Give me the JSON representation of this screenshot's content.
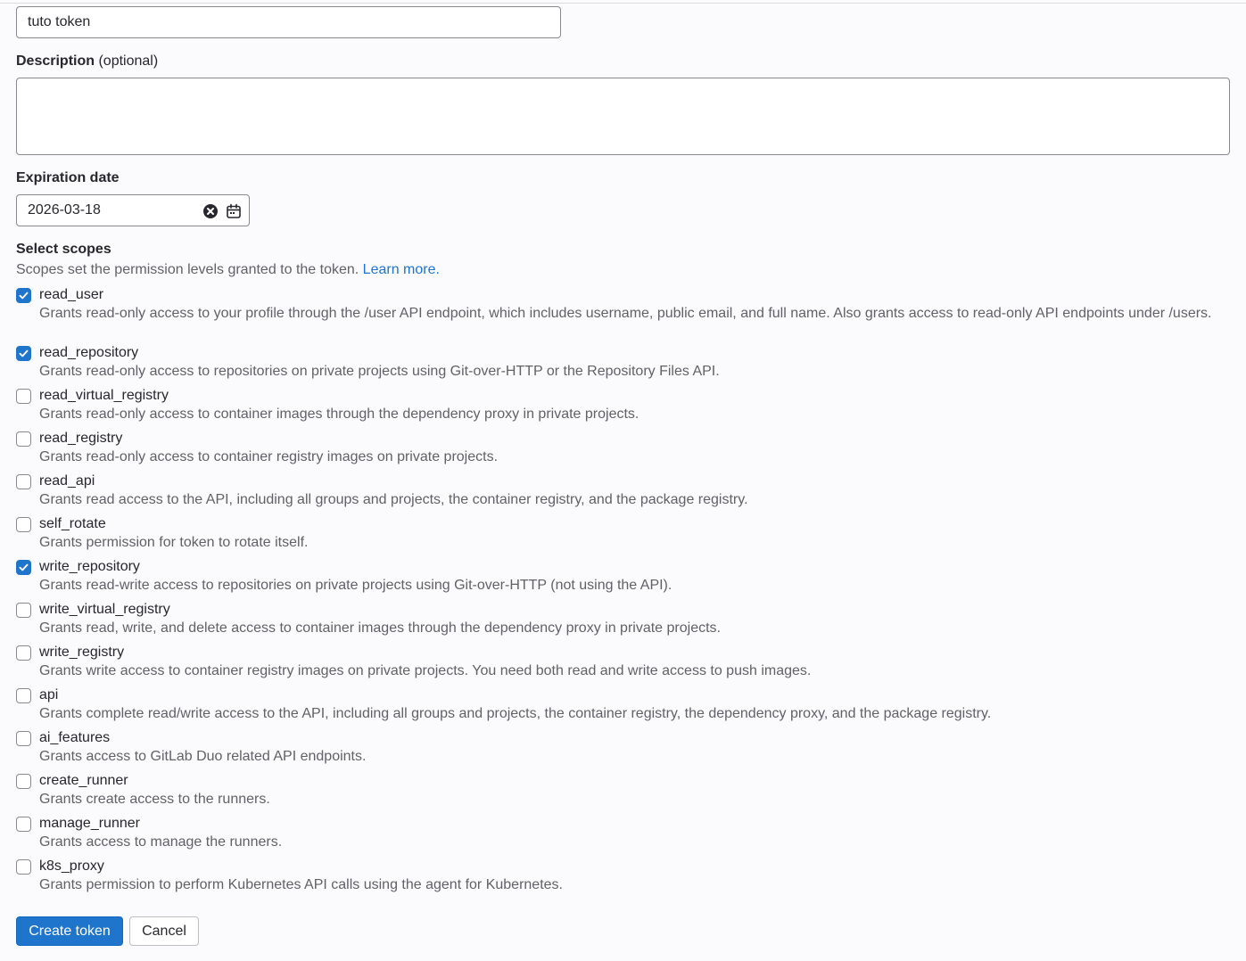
{
  "form": {
    "token_name_value": "tuto token",
    "description_label": "Description",
    "description_optional": "(optional)",
    "description_value": "",
    "expiration_label": "Expiration date",
    "expiration_value": "2026-03-18",
    "scopes_label": "Select scopes",
    "scopes_help": "Scopes set the permission levels granted to the token.",
    "scopes_help_link": "Learn more."
  },
  "scopes": [
    {
      "name": "read_user",
      "checked": true,
      "description": "Grants read-only access to your profile through the /user API endpoint, which includes username, public email, and full name. Also grants access to read-only API endpoints under /users."
    },
    {
      "name": "read_repository",
      "checked": true,
      "description": "Grants read-only access to repositories on private projects using Git-over-HTTP or the Repository Files API."
    },
    {
      "name": "read_virtual_registry",
      "checked": false,
      "description": "Grants read-only access to container images through the dependency proxy in private projects."
    },
    {
      "name": "read_registry",
      "checked": false,
      "description": "Grants read-only access to container registry images on private projects."
    },
    {
      "name": "read_api",
      "checked": false,
      "description": "Grants read access to the API, including all groups and projects, the container registry, and the package registry."
    },
    {
      "name": "self_rotate",
      "checked": false,
      "description": "Grants permission for token to rotate itself."
    },
    {
      "name": "write_repository",
      "checked": true,
      "description": "Grants read-write access to repositories on private projects using Git-over-HTTP (not using the API)."
    },
    {
      "name": "write_virtual_registry",
      "checked": false,
      "description": "Grants read, write, and delete access to container images through the dependency proxy in private projects."
    },
    {
      "name": "write_registry",
      "checked": false,
      "description": "Grants write access to container registry images on private projects. You need both read and write access to push images."
    },
    {
      "name": "api",
      "checked": false,
      "description": "Grants complete read/write access to the API, including all groups and projects, the container registry, the dependency proxy, and the package registry."
    },
    {
      "name": "ai_features",
      "checked": false,
      "description": "Grants access to GitLab Duo related API endpoints."
    },
    {
      "name": "create_runner",
      "checked": false,
      "description": "Grants create access to the runners."
    },
    {
      "name": "manage_runner",
      "checked": false,
      "description": "Grants access to manage the runners."
    },
    {
      "name": "k8s_proxy",
      "checked": false,
      "description": "Grants permission to perform Kubernetes API calls using the agent for Kubernetes."
    }
  ],
  "actions": {
    "create_label": "Create token",
    "cancel_label": "Cancel"
  },
  "colors": {
    "accent": "#1f75cb",
    "text": "#28272d",
    "muted": "#626168"
  },
  "icons": {
    "clear": "clear-circle-icon",
    "calendar": "calendar-icon",
    "check": "checkmark-icon"
  }
}
